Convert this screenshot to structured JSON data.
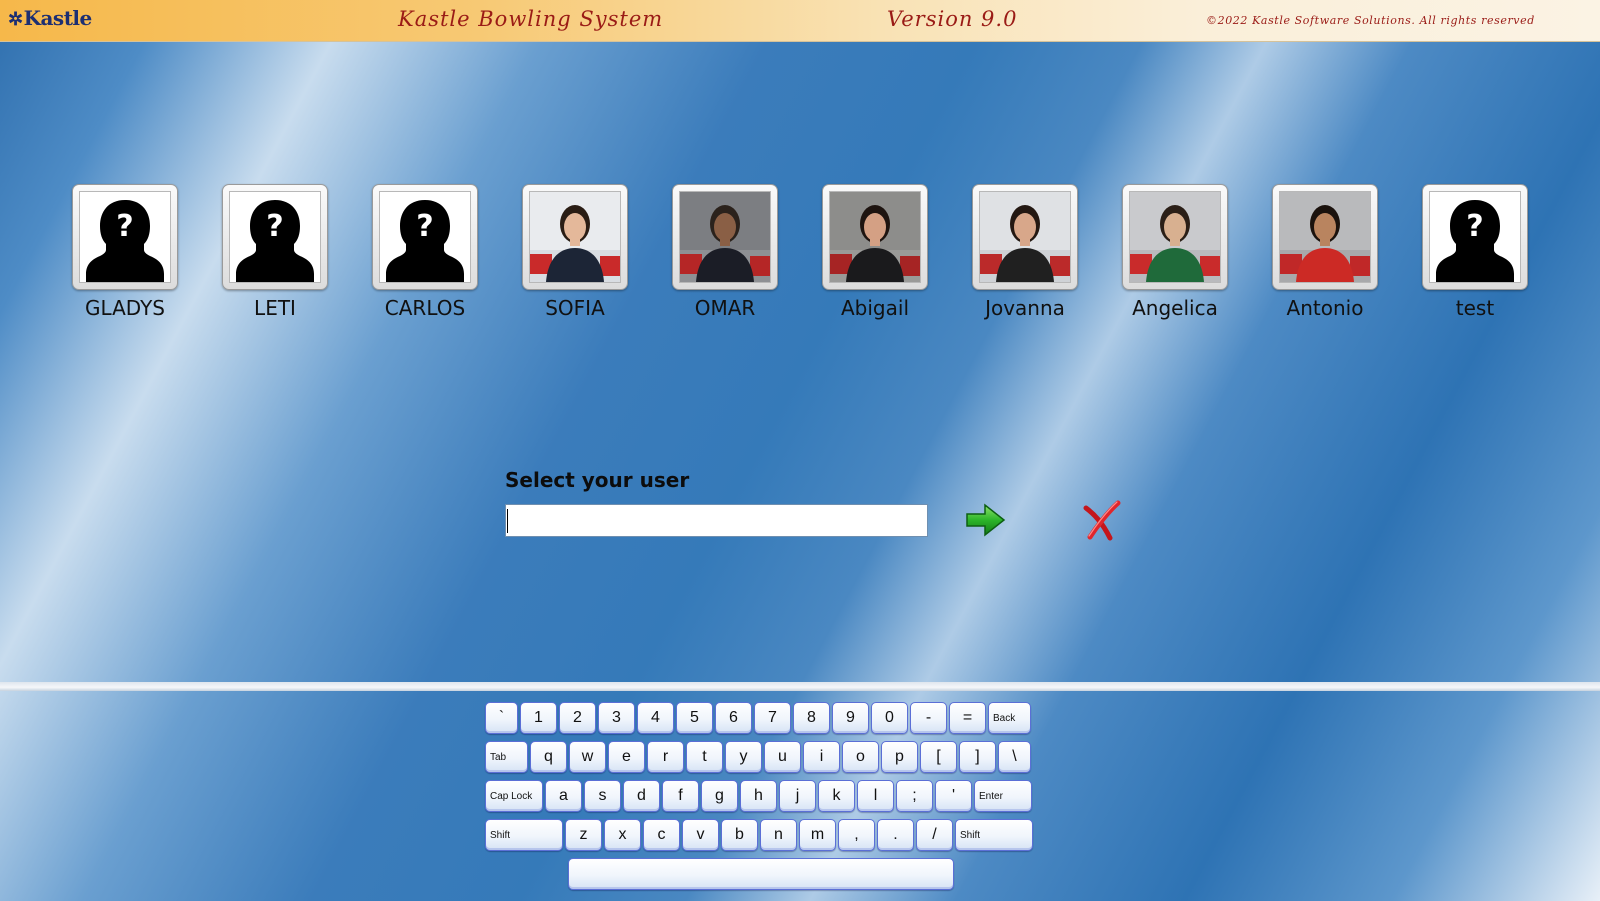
{
  "header": {
    "logo": "Kastle",
    "title": "Kastle Bowling System",
    "version": "Version 9.0",
    "copyright": "©2022 Kastle Software Solutions. All rights reserved"
  },
  "users": [
    {
      "name": "GLADYS",
      "photo": "placeholder"
    },
    {
      "name": "LETI",
      "photo": "placeholder"
    },
    {
      "name": "CARLOS",
      "photo": "placeholder"
    },
    {
      "name": "SOFIA",
      "photo": "photo"
    },
    {
      "name": "OMAR",
      "photo": "photo"
    },
    {
      "name": "Abigail",
      "photo": "photo"
    },
    {
      "name": "Jovanna",
      "photo": "photo"
    },
    {
      "name": "Angelica",
      "photo": "photo"
    },
    {
      "name": "Antonio",
      "photo": "photo"
    },
    {
      "name": "test",
      "photo": "placeholder"
    }
  ],
  "login": {
    "label": "Select your user",
    "value": "",
    "go_icon": "green-arrow-icon",
    "cancel_icon": "red-x-icon"
  },
  "keyboard": {
    "rows": [
      [
        "`",
        "1",
        "2",
        "3",
        "4",
        "5",
        "6",
        "7",
        "8",
        "9",
        "0",
        "-",
        "=",
        "Back"
      ],
      [
        "Tab",
        "q",
        "w",
        "e",
        "r",
        "t",
        "y",
        "u",
        "i",
        "o",
        "p",
        "[",
        "]",
        "\\"
      ],
      [
        "Cap Lock",
        "a",
        "s",
        "d",
        "f",
        "g",
        "h",
        "j",
        "k",
        "l",
        ";",
        "'",
        "Enter"
      ],
      [
        "Shift",
        "z",
        "x",
        "c",
        "v",
        "b",
        "n",
        "m",
        ",",
        ".",
        "/",
        "Shift"
      ],
      [
        " "
      ]
    ]
  },
  "colors": {
    "header_text": "#9a1b16",
    "logo": "#1d2f72",
    "key_border": "#5b6fd6"
  }
}
